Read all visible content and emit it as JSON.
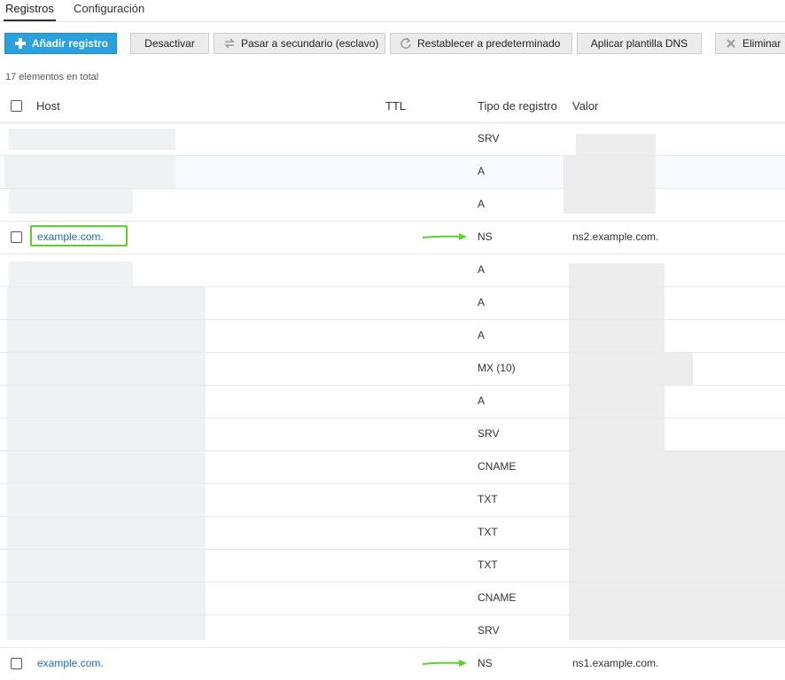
{
  "tabs": [
    {
      "label": "Registros",
      "active": true
    },
    {
      "label": "Configuración",
      "active": false
    }
  ],
  "toolbar": {
    "add": "Añadir registro",
    "deactivate": "Desactivar",
    "secondary": "Pasar a secundario (esclavo)",
    "reset": "Restablecer a predeterminado",
    "template": "Aplicar plantilla DNS",
    "delete": "Eliminar"
  },
  "summary": "17 elementos en total",
  "columns": {
    "host": "Host",
    "ttl": "TTL",
    "type": "Tipo de registro",
    "value": "Valor"
  },
  "rows": [
    {
      "host": "",
      "type": "SRV",
      "value": ""
    },
    {
      "host": "",
      "type": "A",
      "value": ""
    },
    {
      "host": "",
      "type": "A",
      "value": ""
    },
    {
      "host": "example.com.",
      "type": "NS",
      "value": "ns2.example.com."
    },
    {
      "host": "",
      "type": "A",
      "value": ""
    },
    {
      "host": "",
      "type": "A",
      "value": ""
    },
    {
      "host": "",
      "type": "A",
      "value": ""
    },
    {
      "host": "",
      "type": "MX (10)",
      "value": ""
    },
    {
      "host": "",
      "type": "A",
      "value": ""
    },
    {
      "host": "",
      "type": "SRV",
      "value": ""
    },
    {
      "host": "",
      "type": "CNAME",
      "value": ""
    },
    {
      "host": "",
      "type": "TXT",
      "value": ""
    },
    {
      "host": "",
      "type": "TXT",
      "value": ""
    },
    {
      "host": "",
      "type": "TXT",
      "value": ""
    },
    {
      "host": "",
      "type": "CNAME",
      "value": ""
    },
    {
      "host": "",
      "type": "SRV",
      "value": ""
    },
    {
      "host": "example.com.",
      "type": "NS",
      "value": "ns1.example.com."
    }
  ],
  "colors": {
    "accent": "#2aa0df",
    "highlight": "#5bd12d",
    "link": "#1c6fb8"
  }
}
